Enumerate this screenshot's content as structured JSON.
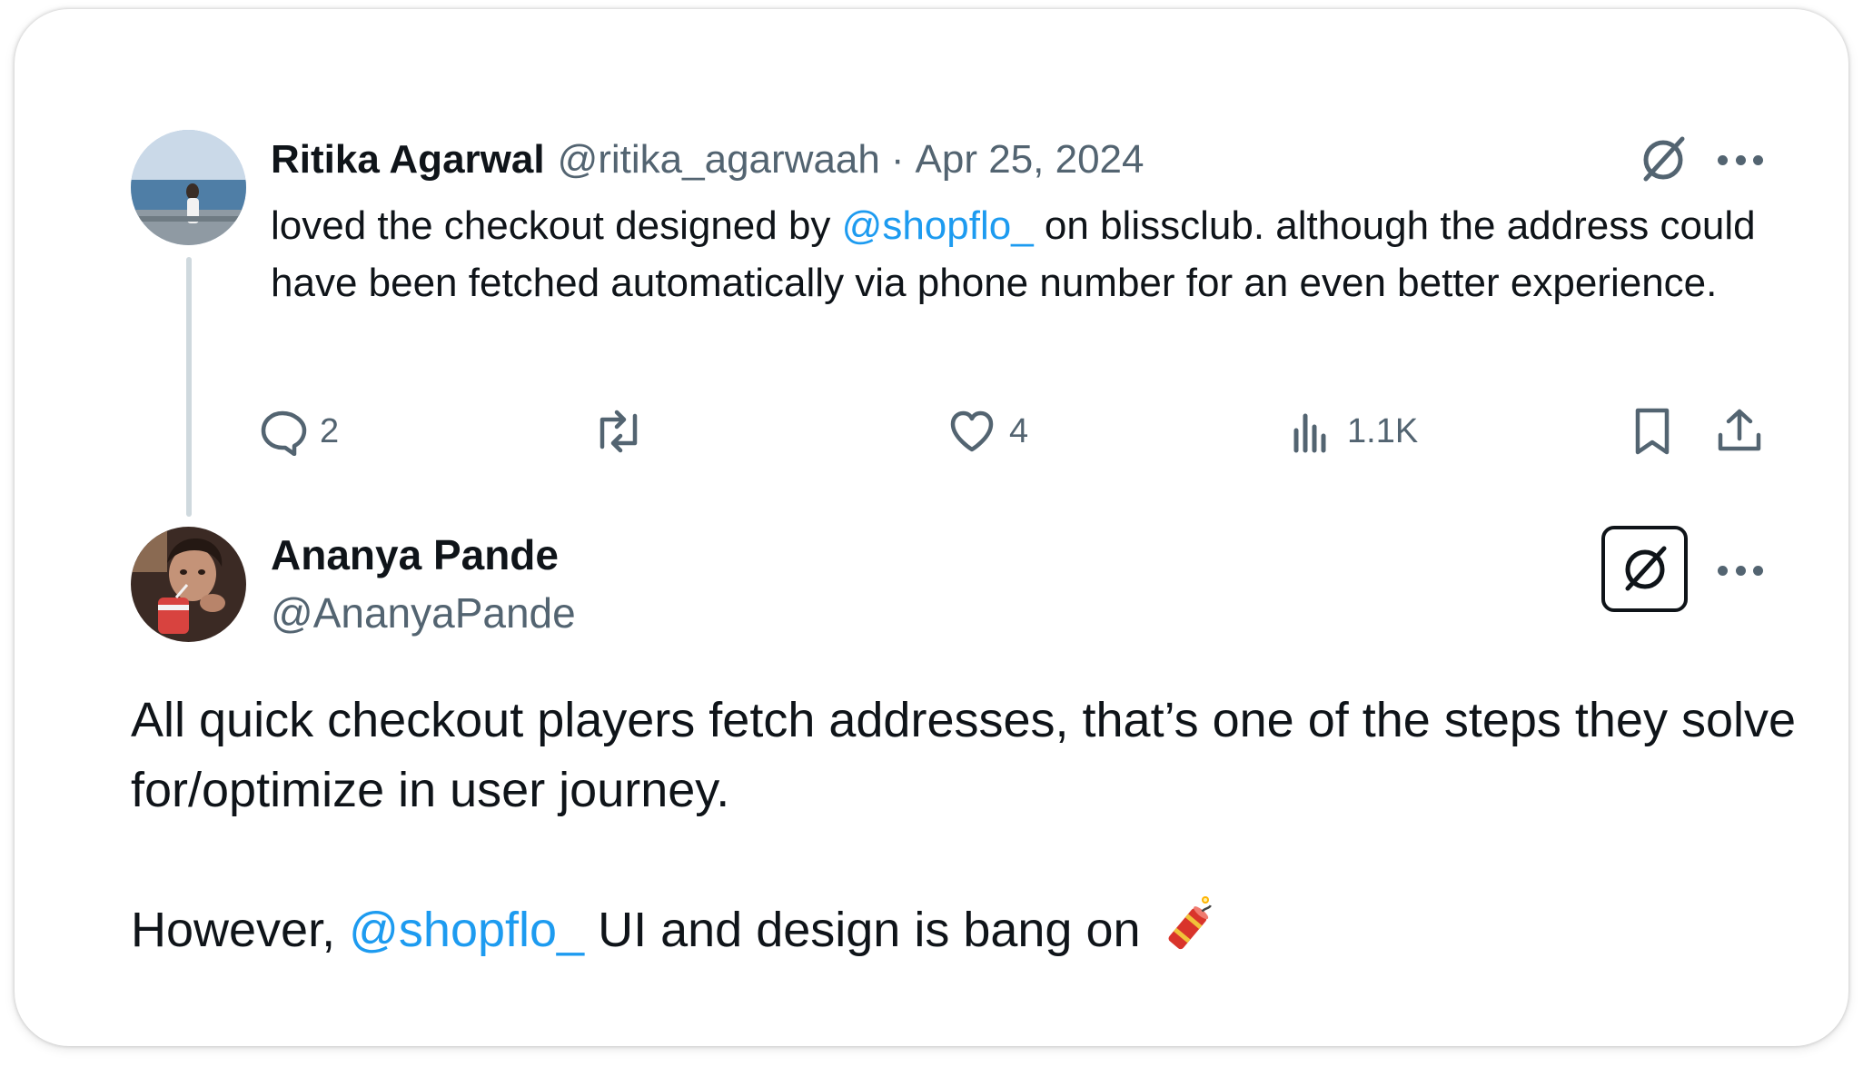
{
  "tweet1": {
    "author_name": "Ritika Agarwal",
    "handle": "@ritika_agarwaah",
    "separator": "·",
    "date": "Apr 25, 2024",
    "text_before": "loved the checkout designed by ",
    "mention": "@shopflo_",
    "text_after": " on blissclub. although the address could have been fetched automatically via phone number for an even better experience.",
    "actions": {
      "replies": "2",
      "likes": "4",
      "views": "1.1K"
    }
  },
  "tweet2": {
    "author_name": "Ananya Pande",
    "handle": "@AnanyaPande",
    "paragraph1": "All quick checkout players fetch addresses, that’s one of the steps they solve for/optimize in user journey.",
    "paragraph2_before": "However, ",
    "mention": "@shopflo_",
    "paragraph2_after": " UI and design is bang on",
    "emoji": "firecracker"
  },
  "icons": {
    "reply": "reply-icon",
    "retweet": "retweet-icon",
    "like": "heart-icon",
    "views": "views-icon",
    "bookmark": "bookmark-icon",
    "share": "share-icon",
    "grok": "grok-icon",
    "more": "more-icon"
  },
  "colors": {
    "text": "#0f1419",
    "muted": "#536471",
    "link": "#1d9bf0",
    "thread_line": "#cfd9de"
  }
}
